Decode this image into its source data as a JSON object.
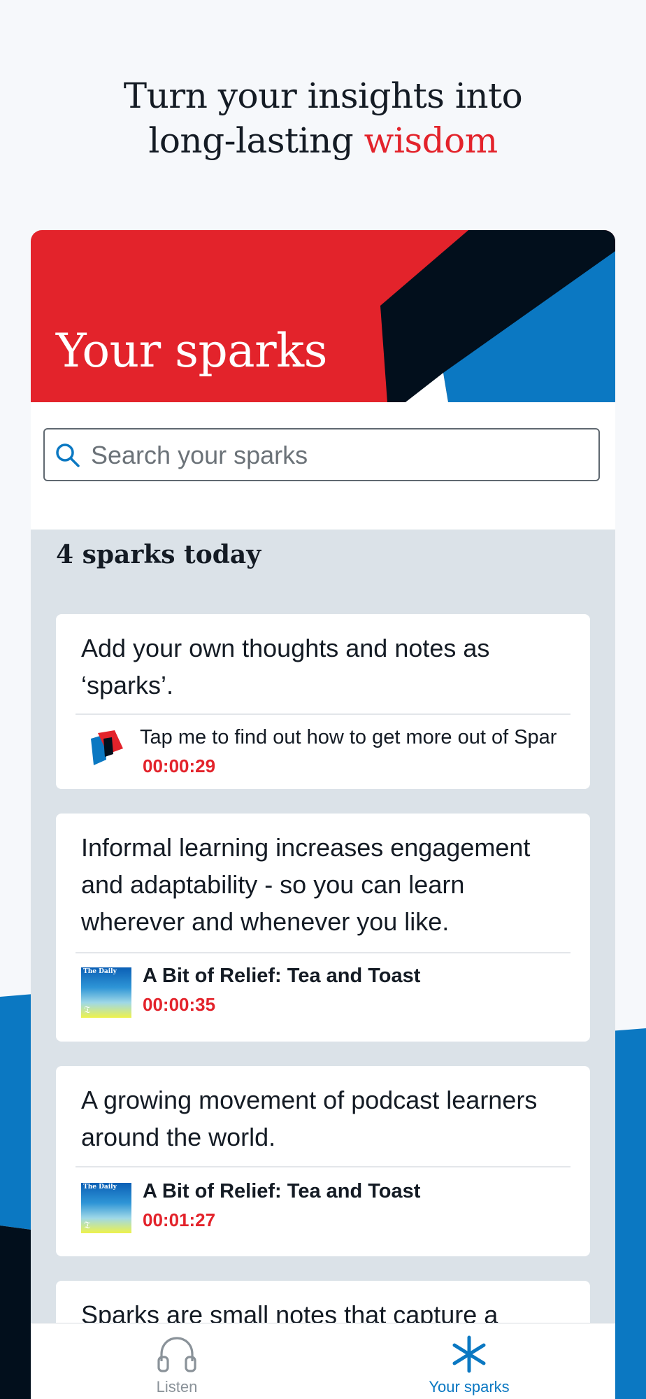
{
  "headline": {
    "line1": "Turn your insights into",
    "line2_prefix": "long-lasting ",
    "line2_accent": "wisdom"
  },
  "banner": {
    "title": "Your sparks"
  },
  "search": {
    "placeholder": "Search your sparks",
    "value": ""
  },
  "feed": {
    "count_label": "4 sparks today",
    "cards": [
      {
        "text": "Add your own thoughts and notes as ‘sparks’.",
        "source_title": "Tap me to find out how to get more out of Spar",
        "timestamp": "00:00:29",
        "thumb": "sparks-logo-icon"
      },
      {
        "text": "Informal learning increases engagement and adaptability - so you can learn wherever and whenever you like.",
        "source_title": "A Bit of Relief: Tea and Toast",
        "timestamp": "00:00:35",
        "thumb": "the-daily-podcast-art",
        "thumb_text": "The Daily",
        "thumb_mark": "𝔗"
      },
      {
        "text": "A growing movement of podcast learners around the world.",
        "source_title": "A Bit of Relief: Tea and Toast",
        "timestamp": "00:01:27",
        "thumb": "the-daily-podcast-art",
        "thumb_text": "The Daily",
        "thumb_mark": "𝔗"
      },
      {
        "text": "Sparks are small notes that capture a"
      }
    ]
  },
  "tabbar": {
    "tabs": [
      {
        "label": "Listen",
        "icon": "headphones-icon",
        "active": false
      },
      {
        "label": "Your sparks",
        "icon": "spark-asterisk-icon",
        "active": true
      }
    ]
  },
  "colors": {
    "brand_red": "#e3232b",
    "brand_blue": "#0b78c2",
    "brand_navy": "#020f1c",
    "text_dark": "#141b24"
  }
}
